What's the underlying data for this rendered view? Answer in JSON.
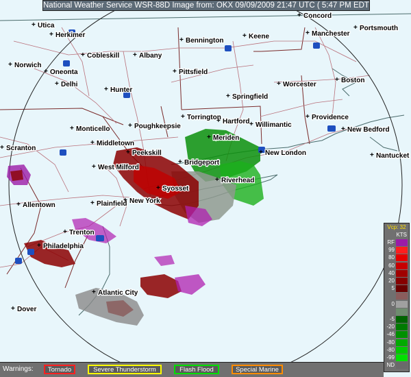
{
  "header": {
    "title": "National Weather Service WSR-88D Image from: OKX 09/09/2009 21:47 UTC ( 5:47 PM EDT)"
  },
  "legend": {
    "mode": "Vcp: 32",
    "units": "KTS",
    "rows": [
      {
        "label": "RF",
        "color": "#9b1ca8"
      },
      {
        "label": "99",
        "color": "#ff1e1e"
      },
      {
        "label": "80",
        "color": "#e60000"
      },
      {
        "label": "60",
        "color": "#c60000"
      },
      {
        "label": "40",
        "color": "#a00000"
      },
      {
        "label": "20",
        "color": "#860000"
      },
      {
        "label": "5",
        "color": "#6a0000"
      },
      {
        "label": "",
        "color": "#8a5d5d"
      },
      {
        "label": "0",
        "color": "#a0a0a0"
      },
      {
        "label": "",
        "color": "#6f8c6f"
      },
      {
        "label": "-5",
        "color": "#006400"
      },
      {
        "label": "-20",
        "color": "#007a00"
      },
      {
        "label": "-46",
        "color": "#009000"
      },
      {
        "label": "-80",
        "color": "#00aa00"
      },
      {
        "label": "-80",
        "color": "#00c800"
      },
      {
        "label": "-99",
        "color": "#00e000"
      },
      {
        "label": "ND",
        "color": "#6a6a6a"
      }
    ]
  },
  "warnings": {
    "label": "Warnings:",
    "items": [
      {
        "label": "Tornado",
        "color": "#ff2020"
      },
      {
        "label": "Severe Thunderstorm",
        "color": "#ffff00"
      },
      {
        "label": "Flash Flood",
        "color": "#00e000"
      },
      {
        "label": "Special Marine",
        "color": "#ff8c00"
      }
    ]
  },
  "map": {
    "cities": [
      {
        "name": "Concord"
      },
      {
        "name": "Utica"
      },
      {
        "name": "Herkimer"
      },
      {
        "name": "Bennington"
      },
      {
        "name": "Keene"
      },
      {
        "name": "Manchester"
      },
      {
        "name": "Portsmouth"
      },
      {
        "name": "Cobleskill"
      },
      {
        "name": "Albany"
      },
      {
        "name": "Norwich"
      },
      {
        "name": "Oneonta"
      },
      {
        "name": "Pittsfield"
      },
      {
        "name": "Delhi"
      },
      {
        "name": "Worcester"
      },
      {
        "name": "Boston"
      },
      {
        "name": "Hunter"
      },
      {
        "name": "Springfield"
      },
      {
        "name": "Torrington"
      },
      {
        "name": "Hartford"
      },
      {
        "name": "Providence"
      },
      {
        "name": "Willimantic"
      },
      {
        "name": "Monticello"
      },
      {
        "name": "Poughkeepsie"
      },
      {
        "name": "New Bedford"
      },
      {
        "name": "Meriden"
      },
      {
        "name": "Middletown"
      },
      {
        "name": "Peekskill"
      },
      {
        "name": "New London"
      },
      {
        "name": "Nantucket"
      },
      {
        "name": "Scranton"
      },
      {
        "name": "Bridgeport"
      },
      {
        "name": "West Milford"
      },
      {
        "name": "Riverhead"
      },
      {
        "name": "Syosset"
      },
      {
        "name": "Allentown"
      },
      {
        "name": "Plainfield"
      },
      {
        "name": "New York"
      },
      {
        "name": "Trenton"
      },
      {
        "name": "Philadelphia"
      },
      {
        "name": "Atlantic City"
      },
      {
        "name": "Dover"
      }
    ],
    "highways": [
      "90",
      "88",
      "87",
      "84",
      "91",
      "89",
      "93",
      "95",
      "195",
      "80",
      "78",
      "76",
      "295",
      "390",
      "72"
    ]
  }
}
